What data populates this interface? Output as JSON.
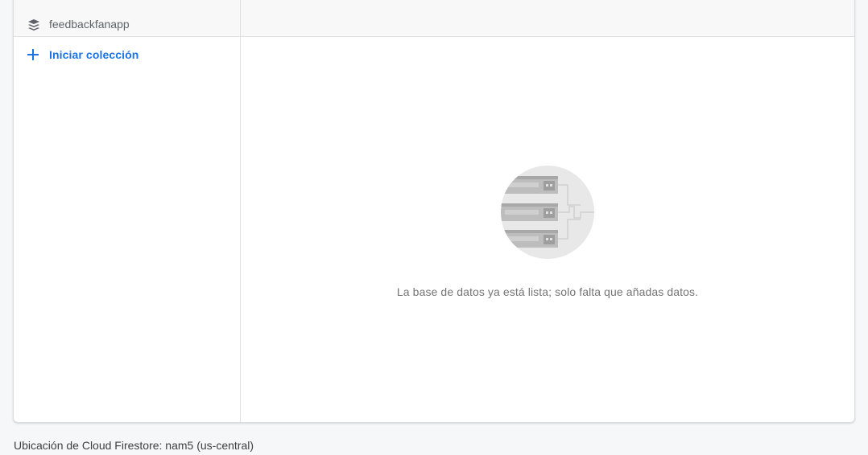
{
  "database": {
    "name": "feedbackfanapp",
    "icon": "firestore-database-icon"
  },
  "actions": {
    "start_collection_label": "Iniciar colección",
    "start_collection_icon": "plus-icon"
  },
  "empty_state": {
    "illustration": "database-servers-icon",
    "message": "La base de datos ya está lista; solo falta que añadas datos."
  },
  "footer": {
    "location": "Ubicación de Cloud Firestore: nam5 (us-central)"
  },
  "colors": {
    "accent": "#1a73e8",
    "text_secondary": "#5f6368",
    "background": "#f6f7f9"
  }
}
